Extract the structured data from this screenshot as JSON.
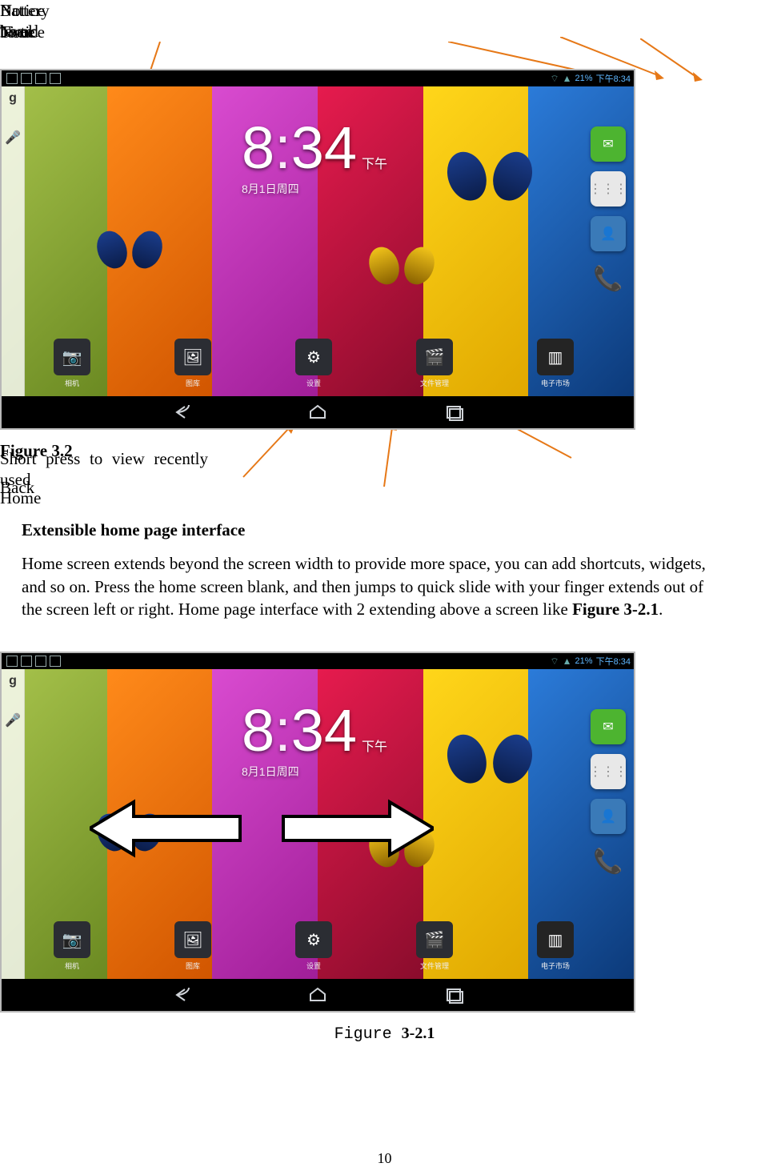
{
  "callouts": {
    "search": "search",
    "notice_board": "Notice board",
    "notice": "Notice",
    "battery": "Battery level",
    "time": "Time",
    "back": "Back",
    "home": "Home",
    "recent": "Short press to view recently used",
    "fig32": "Figure 3.2"
  },
  "status": {
    "battery_pct": "21%",
    "time": "8:34",
    "time_prefix": "下午"
  },
  "clock": {
    "h": "8",
    "m": "34",
    "ampm": "下午",
    "date": "8月1日周四"
  },
  "dock": {
    "camera": "相机",
    "gallery": "图库",
    "settings": "设置",
    "files": "文件管理",
    "market": "电子市场"
  },
  "content": {
    "heading": "Extensible home page interface",
    "para_a": "Home screen extends beyond the screen width to provide more space, you can add shortcuts, widgets, and so on. Press the home screen blank, and then jumps to quick slide with your finger extends out of the screen left or right. Home page interface with 2 extending above a screen like ",
    "para_ref": "Figure 3-2.1",
    "para_end": "."
  },
  "fig2": {
    "lead": "Figure ",
    "num": "3-2.1"
  },
  "page_number": "10"
}
